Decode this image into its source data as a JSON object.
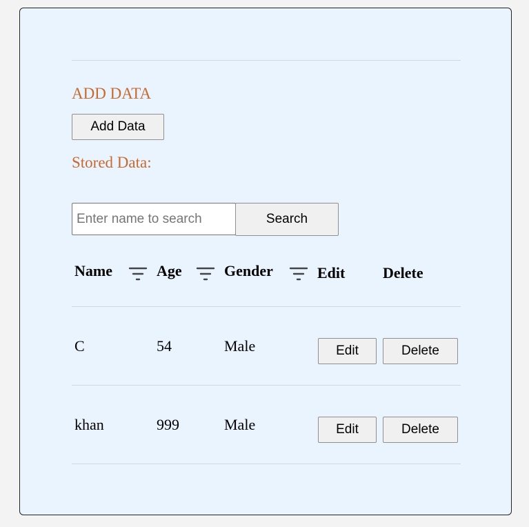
{
  "add_section": {
    "heading": "ADD DATA",
    "add_button_label": "Add Data"
  },
  "stored_section": {
    "heading": "Stored Data:"
  },
  "search": {
    "placeholder": "Enter name to search",
    "value": "",
    "button_label": "Search"
  },
  "table": {
    "headers": {
      "name": "Name",
      "age": "Age",
      "gender": "Gender",
      "edit": "Edit",
      "delete": "Delete"
    },
    "filter_icon": "filter-lines-icon",
    "rows": [
      {
        "name": "C",
        "age": "54",
        "gender": "Male",
        "edit_label": "Edit",
        "delete_label": "Delete"
      },
      {
        "name": "khan",
        "age": "999",
        "gender": "Male",
        "edit_label": "Edit",
        "delete_label": "Delete"
      }
    ]
  },
  "colors": {
    "heading": "#c8692d",
    "card_background": "#eaf4ff",
    "page_background": "#f3f3f3"
  }
}
